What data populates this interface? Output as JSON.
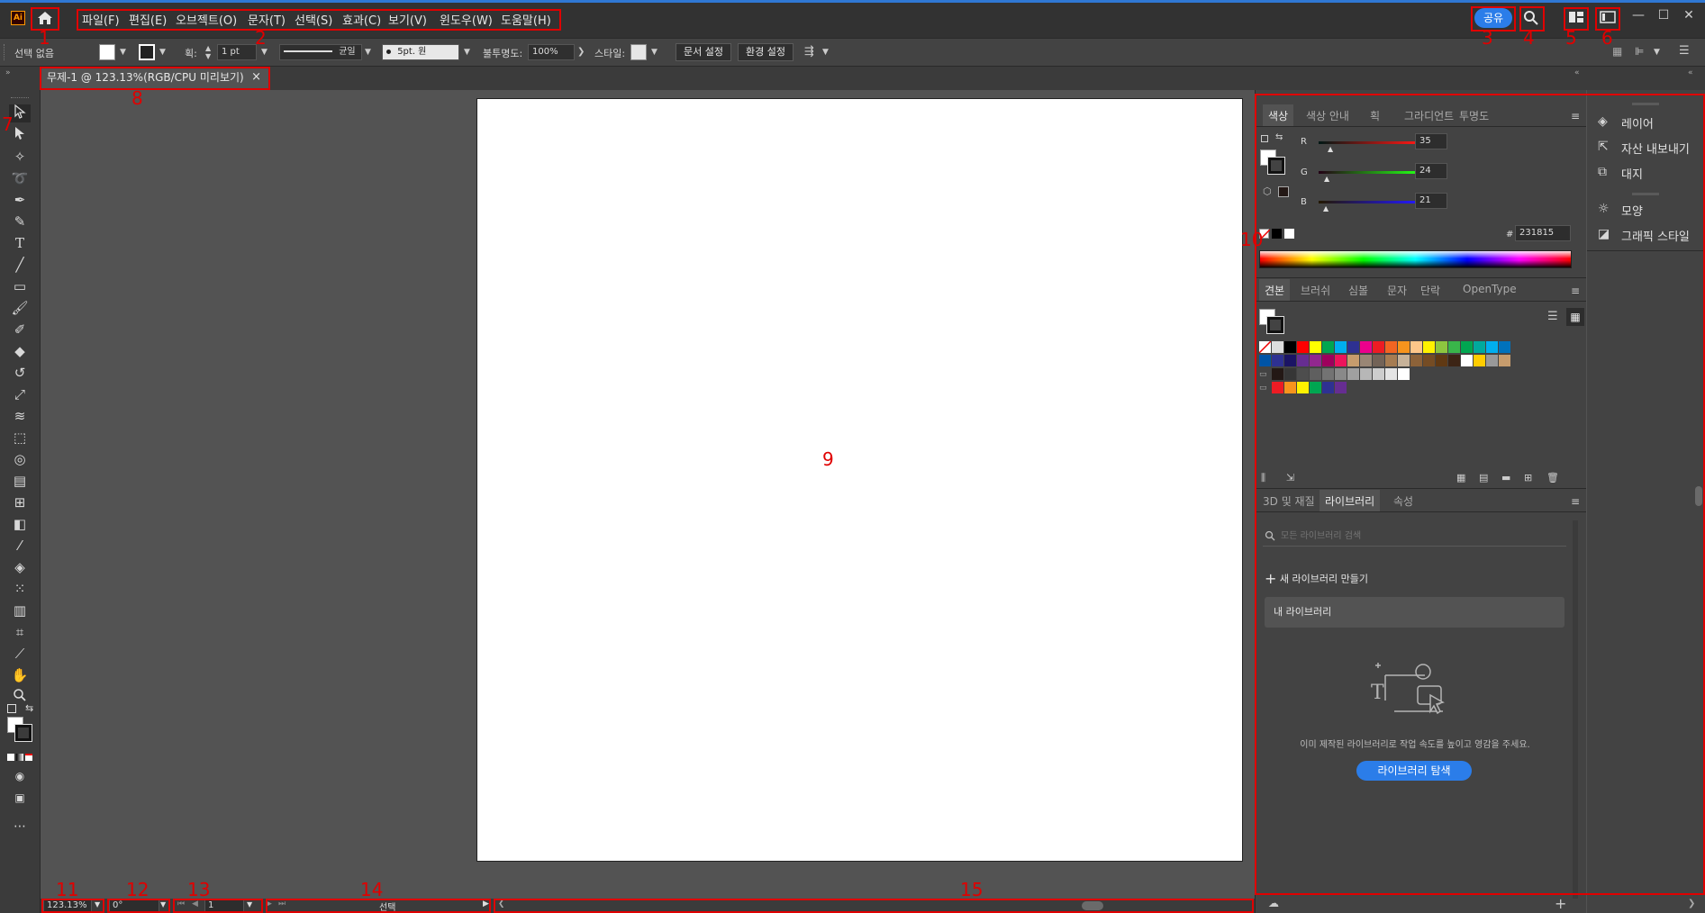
{
  "app": {
    "logo_text": "Ai"
  },
  "menu": [
    "파일(F)",
    "편집(E)",
    "오브젝트(O)",
    "문자(T)",
    "선택(S)",
    "효과(C)",
    "보기(V)",
    "윈도우(W)",
    "도움말(H)"
  ],
  "titlebar": {
    "share_label": "공유",
    "minimize": "—",
    "maximize": "☐",
    "close": "✕"
  },
  "controlbar": {
    "selection_label": "선택 없음",
    "stroke_label": "획:",
    "stroke_value": "1 pt",
    "stroke_profile": "균일",
    "brush_value": "5pt. 원",
    "opacity_label": "불투명도:",
    "opacity_value": "100%",
    "style_label": "스타일:",
    "doc_setup_button": "문서 설정",
    "preferences_button": "환경 설정"
  },
  "document_tab": {
    "title": "무제-1 @ 123.13%(RGB/CPU 미리보기)",
    "close": "×"
  },
  "statusbar": {
    "zoom": "123.13%",
    "rotation": "0°",
    "artboard": "1",
    "status_text": "선택"
  },
  "color_panel": {
    "tabs": [
      "색상",
      "색상 안내",
      "획",
      "그라디언트",
      "투명도"
    ],
    "r_label": "R",
    "g_label": "G",
    "b_label": "B",
    "r_value": "35",
    "g_value": "24",
    "b_value": "21",
    "hex_prefix": "#",
    "hex_value": "231815"
  },
  "swatches_panel": {
    "tabs": [
      "견본",
      "브러쉬",
      "심볼",
      "문자",
      "단락",
      "OpenType"
    ],
    "row1": [
      "#ffffff",
      "#dddddd",
      "#000000",
      "#ff0000",
      "#ffff00",
      "#00a650",
      "#00aeef",
      "#2e3192",
      "#ec008c",
      "#ed1c24",
      "#f26522",
      "#f7941d",
      "#fdc689",
      "#fff200",
      "#8dc63f",
      "#39b54a",
      "#00a651",
      "#00a99d",
      "#00aeef",
      "#0072bc"
    ],
    "row2": [
      "#0054a6",
      "#2e3192",
      "#1b1464",
      "#662d91",
      "#92278f",
      "#9e005d",
      "#ed145b",
      "#c69c6d",
      "#998675",
      "#736357",
      "#a67c52",
      "#c7b299",
      "#8c6239",
      "#754c24",
      "#603913",
      "#3c2415",
      "#ffffff",
      "#ffcc00",
      "#999999",
      "#c69c6d"
    ],
    "row3": [
      "#231815",
      "#363636",
      "#4d4d4d",
      "#5f5f5f",
      "#737373",
      "#898989",
      "#a0a0a0",
      "#b7b7b7",
      "#cdcdcd",
      "#e4e4e4",
      "#ffffff"
    ],
    "row4": [
      "#ed1c24",
      "#f7941d",
      "#fff200",
      "#00a651",
      "#2e3192",
      "#662d91"
    ]
  },
  "libraries_panel": {
    "tabs": [
      "3D 및 재질",
      "라이브러리",
      "속성"
    ],
    "search_placeholder": "모든 라이브러리 검색",
    "new_library": "새 라이브러리 만들기",
    "my_library": "내 라이브러리",
    "empty_text": "이미 제작된 라이브러리로 작업 속도를 높이고 영감을 주세요.",
    "explore_button": "라이브러리 탐색"
  },
  "side_panel": {
    "items": [
      "레이어",
      "자산 내보내기",
      "대지",
      "모양",
      "그래픽 스타일"
    ]
  },
  "annotations": [
    "1",
    "2",
    "3",
    "4",
    "5",
    "6",
    "7",
    "8",
    "9",
    "10",
    "11",
    "12",
    "13",
    "14",
    "15"
  ],
  "colors": {
    "accent": "#2b7de9",
    "annotation": "#e00000"
  }
}
